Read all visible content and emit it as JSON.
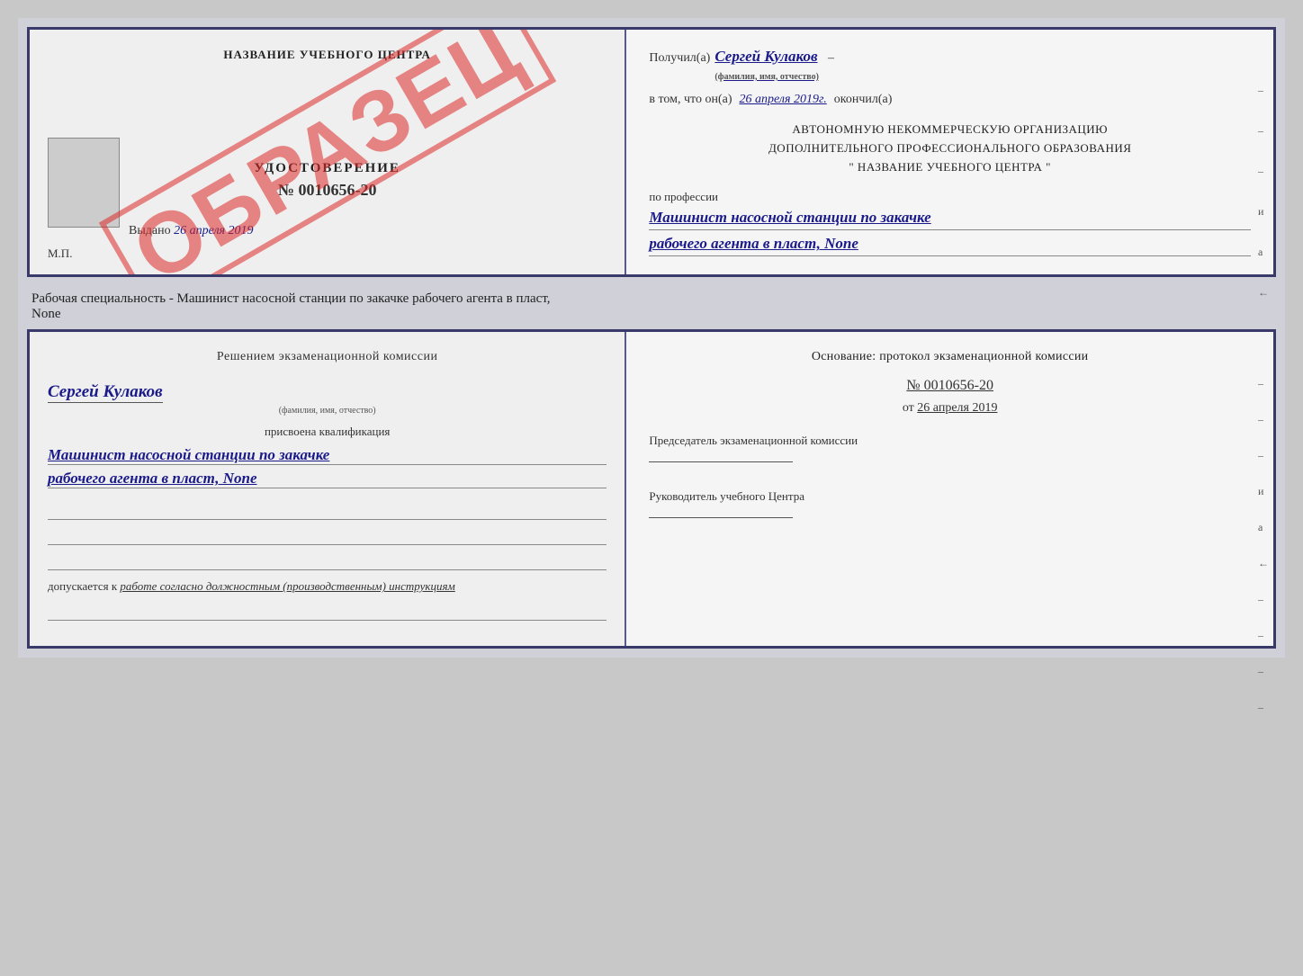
{
  "top_left": {
    "title": "НАЗВАНИЕ УЧЕБНОГО ЦЕНТРА",
    "stamp": "ОБРАЗЕЦ",
    "udostoverenie_label": "УДОСТОВЕРЕНИЕ",
    "number": "№ 0010656-20",
    "vydano_label": "Выдано",
    "vydano_date": "26 апреля 2019",
    "mp_label": "М.П."
  },
  "top_right": {
    "poluchil_label": "Получил(а)",
    "poluchil_name": "Сергей Кулаков",
    "familiya_hint": "(фамилия, имя, отчество)",
    "dash": "–",
    "vtom_label": "в том, что он(а)",
    "vtom_date": "26 апреля 2019г.",
    "okončil_label": "окончил(а)",
    "org_line1": "АВТОНОМНУЮ НЕКОММЕРЧЕСКУЮ ОРГАНИЗАЦИЮ",
    "org_line2": "ДОПОЛНИТЕЛЬНОГО ПРОФЕССИОНАЛЬНОГО ОБРАЗОВАНИЯ",
    "org_line3": "\"  НАЗВАНИЕ УЧЕБНОГО ЦЕНТРА  \"",
    "po_professii": "по профессии",
    "profession1": "Машинист насосной станции по закачке",
    "profession2": "рабочего агента в пласт, None"
  },
  "info_text": {
    "line1": "Рабочая специальность - Машинист насосной станции по закачке рабочего агента в пласт,",
    "line2": "None"
  },
  "bottom_left": {
    "resheniem": "Решением экзаменационной комиссии",
    "name": "Сергей Кулаков",
    "familiya_hint": "(фамилия, имя, отчество)",
    "prisvoena": "присвоена квалификация",
    "kvalif1": "Машинист насосной станции по закачке",
    "kvalif2": "рабочего агента в пласт, None",
    "dopuskaetsya": "допускается к",
    "dopusk_work": "работе согласно должностным (производственным) инструкциям"
  },
  "bottom_right": {
    "osnovanie_label": "Основание: протокол экзаменационной комиссии",
    "protocol_number": "№ 0010656-20",
    "ot_label": "от",
    "ot_date": "26 апреля 2019",
    "chairman_label": "Председатель экзаменационной комиссии",
    "rukovoditel_label": "Руководитель учебного Центра"
  },
  "side_dashes": [
    "-",
    "-",
    "-",
    "и",
    "а",
    "←",
    "-",
    "-",
    "-",
    "-"
  ]
}
